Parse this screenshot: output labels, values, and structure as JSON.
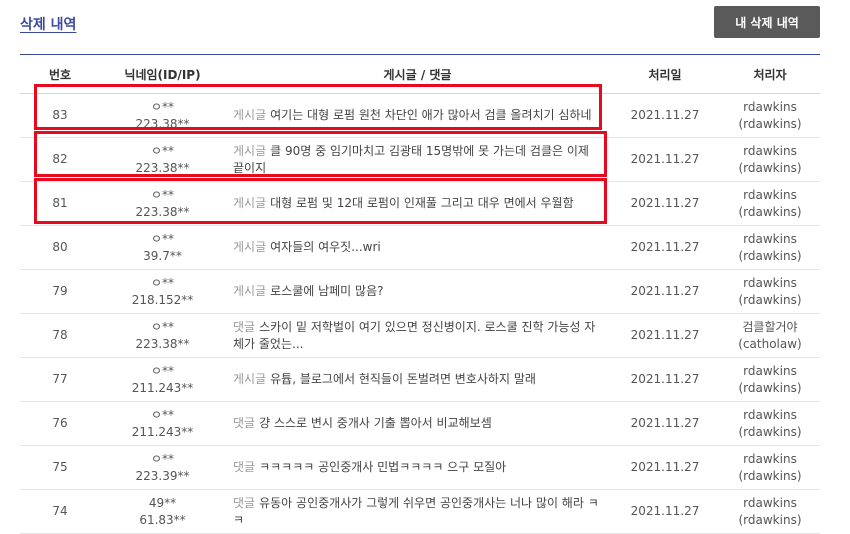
{
  "header": {
    "title": "삭제 내역",
    "my_deletions_button": "내 삭제 내역"
  },
  "table": {
    "columns": [
      "번호",
      "닉네임(ID/IP)",
      "게시글 / 댓글",
      "처리일",
      "처리자"
    ],
    "rows": [
      {
        "no": "83",
        "nick": "ㅇ**",
        "ip": "223.38**",
        "kind": "게시글",
        "text": "여기는 대형 로펌 원천 차단인 애가 많아서 검클 올려치기 심하네",
        "date": "2021.11.27",
        "handler": "rdawkins",
        "handler_id": "(rdawkins)"
      },
      {
        "no": "82",
        "nick": "ㅇ**",
        "ip": "223.38**",
        "kind": "게시글",
        "text": "클 90명 중 임기마치고 김광태 15명밖에 못 가는데 검클은 이제 끝이지",
        "date": "2021.11.27",
        "handler": "rdawkins",
        "handler_id": "(rdawkins)"
      },
      {
        "no": "81",
        "nick": "ㅇ**",
        "ip": "223.38**",
        "kind": "게시글",
        "text": "대형 로펌 및 12대 로펌이 인재풀 그리고 대우 면에서 우월함",
        "date": "2021.11.27",
        "handler": "rdawkins",
        "handler_id": "(rdawkins)"
      },
      {
        "no": "80",
        "nick": "ㅇ**",
        "ip": "39.7**",
        "kind": "게시글",
        "text": "여자들의 여우짓...wri",
        "date": "2021.11.27",
        "handler": "rdawkins",
        "handler_id": "(rdawkins)"
      },
      {
        "no": "79",
        "nick": "ㅇ**",
        "ip": "218.152**",
        "kind": "게시글",
        "text": "로스쿨에 남페미 많음?",
        "date": "2021.11.27",
        "handler": "rdawkins",
        "handler_id": "(rdawkins)"
      },
      {
        "no": "78",
        "nick": "ㅇ**",
        "ip": "223.38**",
        "kind": "댓글",
        "text": "스카이 밑 저학벌이 여기 있으면 정신병이지. 로스쿨 진학 가능성 자체가 줄었는...",
        "date": "2021.11.27",
        "handler": "검클할거야",
        "handler_id": "(catholaw)"
      },
      {
        "no": "77",
        "nick": "ㅇ**",
        "ip": "211.243**",
        "kind": "게시글",
        "text": "유튭, 블로그에서 현직들이 돈벌려면 변호사하지 말래",
        "date": "2021.11.27",
        "handler": "rdawkins",
        "handler_id": "(rdawkins)"
      },
      {
        "no": "76",
        "nick": "ㅇ**",
        "ip": "211.243**",
        "kind": "댓글",
        "text": "걍 스스로 변시 중개사 기출 뽑아서 비교해보셈",
        "date": "2021.11.27",
        "handler": "rdawkins",
        "handler_id": "(rdawkins)"
      },
      {
        "no": "75",
        "nick": "ㅇ**",
        "ip": "223.39**",
        "kind": "댓글",
        "text": "ㅋㅋㅋㅋㅋ 공인중개사 민법ㅋㅋㅋㅋ 으구 모질아",
        "date": "2021.11.27",
        "handler": "rdawkins",
        "handler_id": "(rdawkins)"
      },
      {
        "no": "74",
        "nick": "49**",
        "ip": "61.83**",
        "kind": "댓글",
        "text": "유동아 공인중개사가 그렇게 쉬우면 공인중개사는 너나 많이 해라 ㅋㅋ",
        "date": "2021.11.27",
        "handler": "rdawkins",
        "handler_id": "(rdawkins)"
      }
    ]
  }
}
